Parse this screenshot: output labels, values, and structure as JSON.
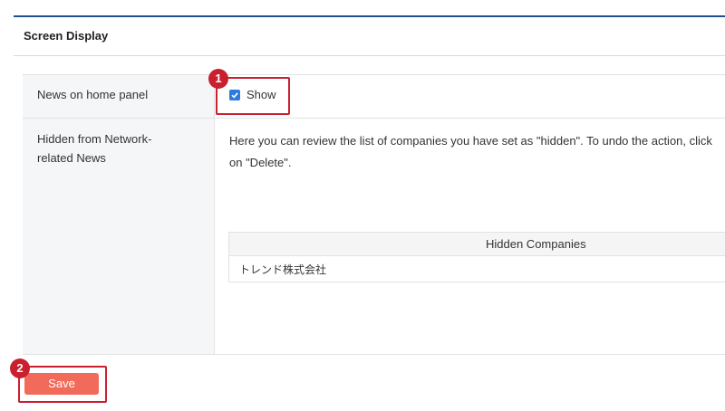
{
  "section": {
    "title": "Screen Display"
  },
  "rows": {
    "news_label": "News on home panel",
    "hidden_label_line1": "Hidden from Network-",
    "hidden_label_line2": "related News"
  },
  "news_checkbox": {
    "checked": true,
    "label": "Show"
  },
  "description": {
    "line1": "Here you can review the list of companies you have set as \"hidden\". To undo the action, click",
    "line2": "on \"Delete\"."
  },
  "hidden_companies": {
    "header": "Hidden Companies",
    "rows": [
      "トレンド株式会社"
    ]
  },
  "save_label": "Save",
  "annotations": {
    "badge1": "1",
    "badge2": "2"
  },
  "colors": {
    "accent": "#c8202e",
    "save": "#f26a5a",
    "checkbox": "#2e7be0",
    "rule": "#1f4f8c"
  }
}
